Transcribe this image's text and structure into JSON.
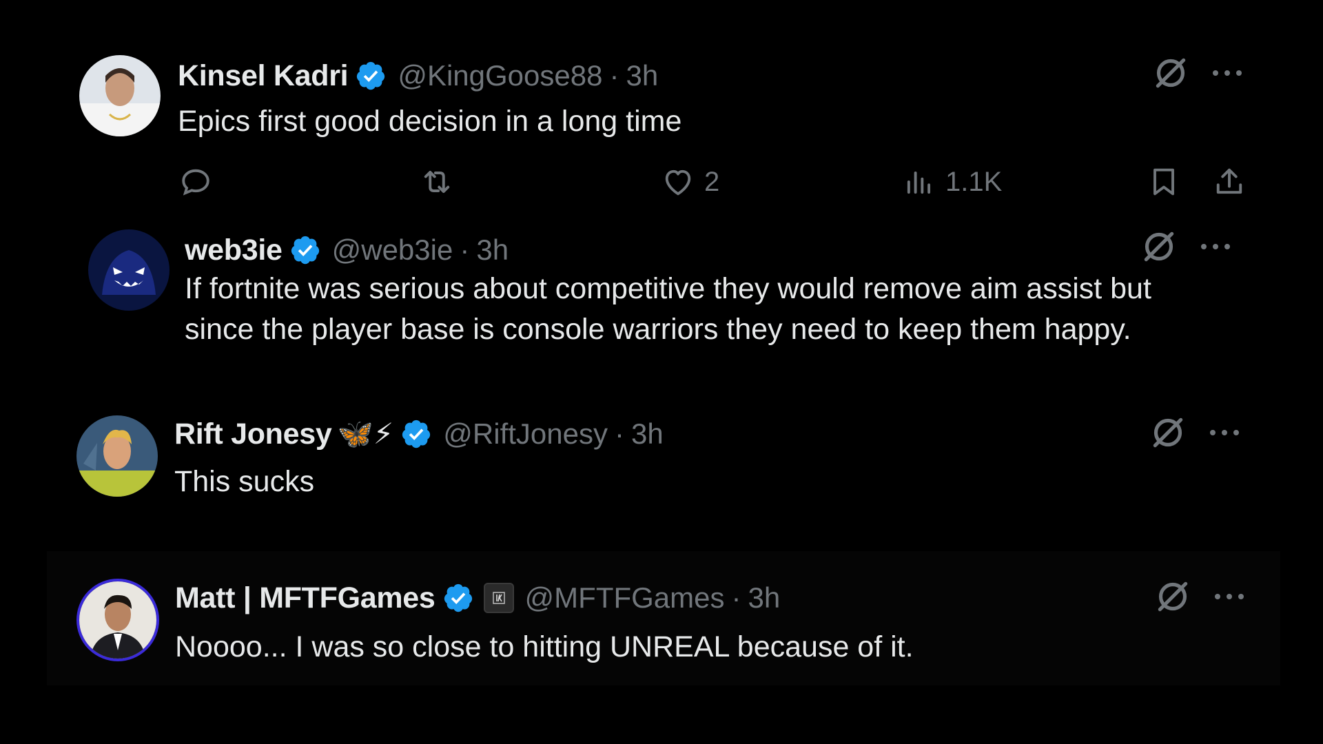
{
  "colors": {
    "background": "#000000",
    "text": "#e7e9ea",
    "secondary": "#71767b",
    "verified": "#1d9bf0"
  },
  "tweets": [
    {
      "name": "Kinsel Kadri",
      "handle": "@KingGoose88",
      "separator": "·",
      "time": "3h",
      "text": "Epics first good decision in a long time",
      "actions": {
        "reply_icon": "reply-icon",
        "retweet_icon": "retweet-icon",
        "like_icon": "heart-icon",
        "likes": "2",
        "views_icon": "views-icon",
        "views": "1.1K",
        "bookmark_icon": "bookmark-icon",
        "share_icon": "share-icon"
      }
    },
    {
      "name": "web3ie",
      "handle": "@web3ie",
      "separator": "·",
      "time": "3h",
      "text_lines": [
        "If fortnite was serious about competitive they would remove aim assist but",
        "since the player base is console warriors they need to keep them happy."
      ]
    },
    {
      "name": "Rift Jonesy",
      "emoji": "🦋⚡",
      "handle": "@RiftJonesy",
      "separator": "·",
      "time": "3h",
      "text": "This sucks"
    },
    {
      "name": "Matt | MFTFGames",
      "handle": "@MFTFGames",
      "separator": "·",
      "time": "3h",
      "text": "Noooo... I was so close to hitting UNREAL because of it."
    }
  ]
}
